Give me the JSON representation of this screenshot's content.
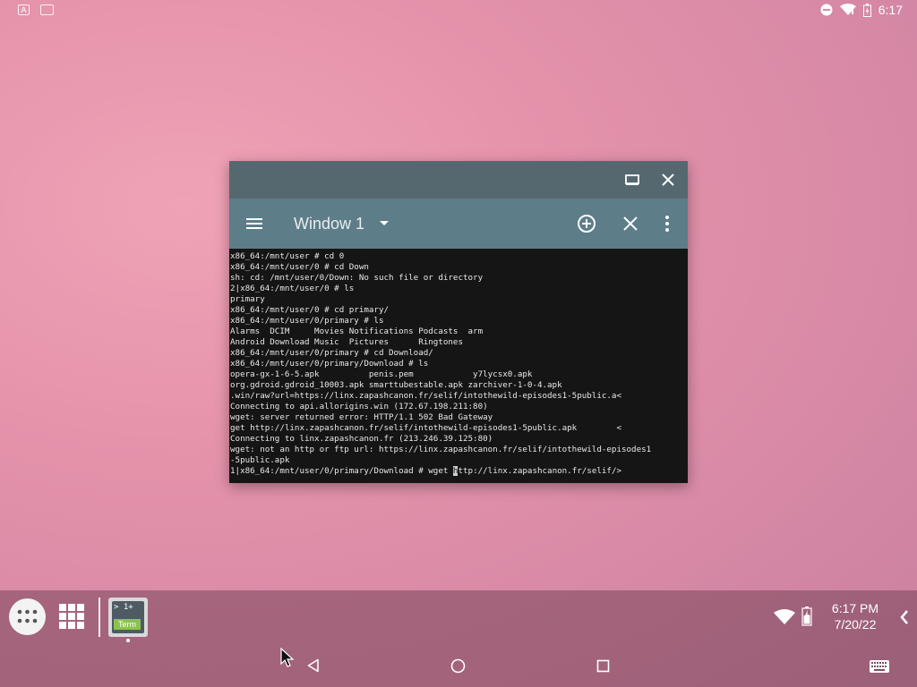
{
  "statusbar": {
    "left_icons": [
      "font-notification-icon",
      "screenshot-notification-icon"
    ],
    "right_icons": [
      "do-not-disturb-icon",
      "wifi-icon",
      "battery-icon"
    ],
    "time": "6:17"
  },
  "terminal_window": {
    "caption_buttons": [
      "maximize-icon",
      "close-icon"
    ],
    "title": "Window 1",
    "actions": [
      "add-window-icon",
      "close-window-icon",
      "more-options-icon"
    ],
    "lines": [
      "x86_64:/mnt/user # cd 0",
      "x86_64:/mnt/user/0 # cd Down",
      "sh: cd: /mnt/user/0/Down: No such file or directory",
      "2|x86_64:/mnt/user/0 # ls",
      "primary",
      "x86_64:/mnt/user/0 # cd primary/",
      "x86_64:/mnt/user/0/primary # ls",
      "Alarms  DCIM     Movies Notifications Podcasts  arm",
      "Android Download Music  Pictures      Ringtones",
      "x86_64:/mnt/user/0/primary # cd Download/",
      "x86_64:/mnt/user/0/primary/Download # ls",
      "opera-gx-1-6-5.apk          penis.pem            y7lycsx0.apk",
      "org.gdroid.gdroid_10003.apk smarttubestable.apk zarchiver-1-0-4.apk",
      ".win/raw?url=https://linx.zapashcanon.fr/selif/intothewild-episodes1-5public.a<",
      "Connecting to api.allorigins.win (172.67.198.211:80)",
      "wget: server returned error: HTTP/1.1 502 Bad Gateway",
      "get http://linx.zapashcanon.fr/selif/intothewild-episodes1-5public.apk        <",
      "Connecting to linx.zapashcanon.fr (213.246.39.125:80)",
      "wget: not an http or ftp url: https://linx.zapashcanon.fr/selif/intothewild-episodes1",
      "-5public.apk"
    ],
    "prompt_before_cursor": "1|x86_64:/mnt/user/0/primary/Download # wget ",
    "cursor_char": "h",
    "prompt_after_cursor": "ttp://linx.zapashcanon.fr/selif/>"
  },
  "taskbar": {
    "pinned_app_label_top": "> 1+",
    "pinned_app_label_bottom": "Term",
    "clock_time": "6:17 PM",
    "clock_date": "7/20/22"
  },
  "colors": {
    "caption": "#56686f",
    "app_bar": "#5d7d89",
    "terminal_bg": "#151515",
    "terminal_fg": "#e8e8e8",
    "term_badge": "#8bc34a"
  }
}
